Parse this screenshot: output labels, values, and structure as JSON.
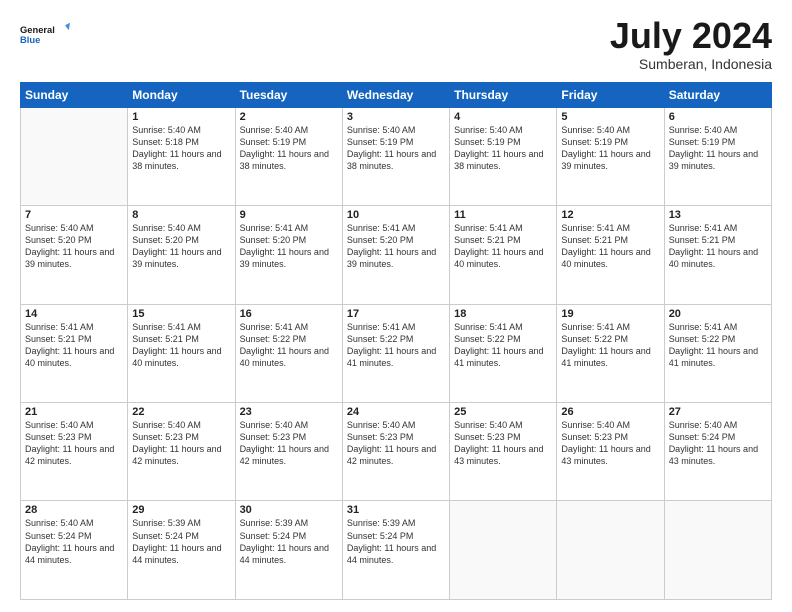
{
  "header": {
    "logo_line1": "General",
    "logo_line2": "Blue",
    "month": "July 2024",
    "location": "Sumberan, Indonesia"
  },
  "days_of_week": [
    "Sunday",
    "Monday",
    "Tuesday",
    "Wednesday",
    "Thursday",
    "Friday",
    "Saturday"
  ],
  "weeks": [
    [
      {
        "day": "",
        "sunrise": "",
        "sunset": "",
        "daylight": ""
      },
      {
        "day": "1",
        "sunrise": "Sunrise: 5:40 AM",
        "sunset": "Sunset: 5:18 PM",
        "daylight": "Daylight: 11 hours and 38 minutes."
      },
      {
        "day": "2",
        "sunrise": "Sunrise: 5:40 AM",
        "sunset": "Sunset: 5:19 PM",
        "daylight": "Daylight: 11 hours and 38 minutes."
      },
      {
        "day": "3",
        "sunrise": "Sunrise: 5:40 AM",
        "sunset": "Sunset: 5:19 PM",
        "daylight": "Daylight: 11 hours and 38 minutes."
      },
      {
        "day": "4",
        "sunrise": "Sunrise: 5:40 AM",
        "sunset": "Sunset: 5:19 PM",
        "daylight": "Daylight: 11 hours and 38 minutes."
      },
      {
        "day": "5",
        "sunrise": "Sunrise: 5:40 AM",
        "sunset": "Sunset: 5:19 PM",
        "daylight": "Daylight: 11 hours and 39 minutes."
      },
      {
        "day": "6",
        "sunrise": "Sunrise: 5:40 AM",
        "sunset": "Sunset: 5:19 PM",
        "daylight": "Daylight: 11 hours and 39 minutes."
      }
    ],
    [
      {
        "day": "7",
        "sunrise": "Sunrise: 5:40 AM",
        "sunset": "Sunset: 5:20 PM",
        "daylight": "Daylight: 11 hours and 39 minutes."
      },
      {
        "day": "8",
        "sunrise": "Sunrise: 5:40 AM",
        "sunset": "Sunset: 5:20 PM",
        "daylight": "Daylight: 11 hours and 39 minutes."
      },
      {
        "day": "9",
        "sunrise": "Sunrise: 5:41 AM",
        "sunset": "Sunset: 5:20 PM",
        "daylight": "Daylight: 11 hours and 39 minutes."
      },
      {
        "day": "10",
        "sunrise": "Sunrise: 5:41 AM",
        "sunset": "Sunset: 5:20 PM",
        "daylight": "Daylight: 11 hours and 39 minutes."
      },
      {
        "day": "11",
        "sunrise": "Sunrise: 5:41 AM",
        "sunset": "Sunset: 5:21 PM",
        "daylight": "Daylight: 11 hours and 40 minutes."
      },
      {
        "day": "12",
        "sunrise": "Sunrise: 5:41 AM",
        "sunset": "Sunset: 5:21 PM",
        "daylight": "Daylight: 11 hours and 40 minutes."
      },
      {
        "day": "13",
        "sunrise": "Sunrise: 5:41 AM",
        "sunset": "Sunset: 5:21 PM",
        "daylight": "Daylight: 11 hours and 40 minutes."
      }
    ],
    [
      {
        "day": "14",
        "sunrise": "Sunrise: 5:41 AM",
        "sunset": "Sunset: 5:21 PM",
        "daylight": "Daylight: 11 hours and 40 minutes."
      },
      {
        "day": "15",
        "sunrise": "Sunrise: 5:41 AM",
        "sunset": "Sunset: 5:21 PM",
        "daylight": "Daylight: 11 hours and 40 minutes."
      },
      {
        "day": "16",
        "sunrise": "Sunrise: 5:41 AM",
        "sunset": "Sunset: 5:22 PM",
        "daylight": "Daylight: 11 hours and 40 minutes."
      },
      {
        "day": "17",
        "sunrise": "Sunrise: 5:41 AM",
        "sunset": "Sunset: 5:22 PM",
        "daylight": "Daylight: 11 hours and 41 minutes."
      },
      {
        "day": "18",
        "sunrise": "Sunrise: 5:41 AM",
        "sunset": "Sunset: 5:22 PM",
        "daylight": "Daylight: 11 hours and 41 minutes."
      },
      {
        "day": "19",
        "sunrise": "Sunrise: 5:41 AM",
        "sunset": "Sunset: 5:22 PM",
        "daylight": "Daylight: 11 hours and 41 minutes."
      },
      {
        "day": "20",
        "sunrise": "Sunrise: 5:41 AM",
        "sunset": "Sunset: 5:22 PM",
        "daylight": "Daylight: 11 hours and 41 minutes."
      }
    ],
    [
      {
        "day": "21",
        "sunrise": "Sunrise: 5:40 AM",
        "sunset": "Sunset: 5:23 PM",
        "daylight": "Daylight: 11 hours and 42 minutes."
      },
      {
        "day": "22",
        "sunrise": "Sunrise: 5:40 AM",
        "sunset": "Sunset: 5:23 PM",
        "daylight": "Daylight: 11 hours and 42 minutes."
      },
      {
        "day": "23",
        "sunrise": "Sunrise: 5:40 AM",
        "sunset": "Sunset: 5:23 PM",
        "daylight": "Daylight: 11 hours and 42 minutes."
      },
      {
        "day": "24",
        "sunrise": "Sunrise: 5:40 AM",
        "sunset": "Sunset: 5:23 PM",
        "daylight": "Daylight: 11 hours and 42 minutes."
      },
      {
        "day": "25",
        "sunrise": "Sunrise: 5:40 AM",
        "sunset": "Sunset: 5:23 PM",
        "daylight": "Daylight: 11 hours and 43 minutes."
      },
      {
        "day": "26",
        "sunrise": "Sunrise: 5:40 AM",
        "sunset": "Sunset: 5:23 PM",
        "daylight": "Daylight: 11 hours and 43 minutes."
      },
      {
        "day": "27",
        "sunrise": "Sunrise: 5:40 AM",
        "sunset": "Sunset: 5:24 PM",
        "daylight": "Daylight: 11 hours and 43 minutes."
      }
    ],
    [
      {
        "day": "28",
        "sunrise": "Sunrise: 5:40 AM",
        "sunset": "Sunset: 5:24 PM",
        "daylight": "Daylight: 11 hours and 44 minutes."
      },
      {
        "day": "29",
        "sunrise": "Sunrise: 5:39 AM",
        "sunset": "Sunset: 5:24 PM",
        "daylight": "Daylight: 11 hours and 44 minutes."
      },
      {
        "day": "30",
        "sunrise": "Sunrise: 5:39 AM",
        "sunset": "Sunset: 5:24 PM",
        "daylight": "Daylight: 11 hours and 44 minutes."
      },
      {
        "day": "31",
        "sunrise": "Sunrise: 5:39 AM",
        "sunset": "Sunset: 5:24 PM",
        "daylight": "Daylight: 11 hours and 44 minutes."
      },
      {
        "day": "",
        "sunrise": "",
        "sunset": "",
        "daylight": ""
      },
      {
        "day": "",
        "sunrise": "",
        "sunset": "",
        "daylight": ""
      },
      {
        "day": "",
        "sunrise": "",
        "sunset": "",
        "daylight": ""
      }
    ]
  ]
}
